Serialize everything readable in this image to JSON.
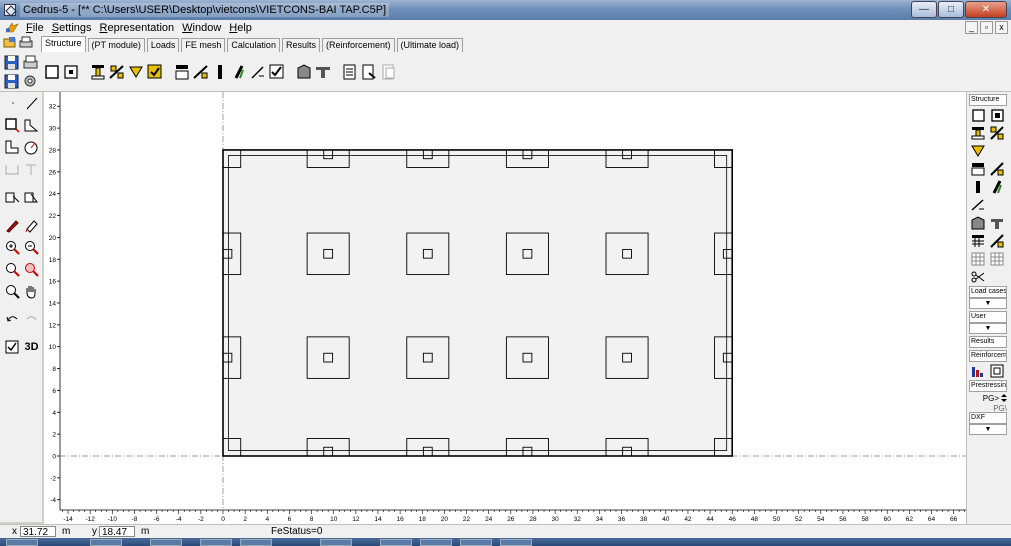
{
  "window": {
    "title": "Cedrus-5 - [** C:\\Users\\USER\\Desktop\\vietcons\\VIETCONS-BAI TAP.C5P]",
    "minimize": "—",
    "maximize": "□",
    "close": "✕"
  },
  "menu": {
    "items": [
      {
        "key": "F",
        "rest": "ile"
      },
      {
        "key": "S",
        "rest": "ettings"
      },
      {
        "key": "R",
        "rest": "epresentation"
      },
      {
        "key": "W",
        "rest": "indow"
      },
      {
        "key": "H",
        "rest": "elp"
      }
    ],
    "mdi": [
      "_",
      "▫",
      "x"
    ]
  },
  "tabs": [
    {
      "label": "Structure",
      "active": true
    },
    {
      "label": "(PT module)",
      "active": false
    },
    {
      "label": "Loads",
      "active": false
    },
    {
      "label": "FE mesh",
      "active": false
    },
    {
      "label": "Calculation",
      "active": false
    },
    {
      "label": "Results",
      "active": false
    },
    {
      "label": "(Reinforcement)",
      "active": false
    },
    {
      "label": "(Ultimate load)",
      "active": false
    }
  ],
  "left_toolbar": {
    "three_d_label": "3D"
  },
  "axes": {
    "y_ticks": [
      32,
      30,
      28,
      26,
      24,
      22,
      20,
      18,
      16,
      14,
      12,
      10,
      8,
      6,
      4,
      2,
      0,
      -2,
      -4
    ],
    "x_ticks": [
      -14,
      -12,
      -10,
      -8,
      -6,
      -4,
      -2,
      0,
      2,
      4,
      6,
      8,
      10,
      12,
      14,
      16,
      18,
      20,
      22,
      24,
      26,
      28,
      30,
      32,
      34,
      36,
      38,
      40,
      42,
      44,
      46,
      48,
      50,
      52,
      54,
      56,
      58,
      60,
      62,
      64,
      66
    ]
  },
  "structure": {
    "slab": {
      "x0": 0,
      "y0": 0,
      "x1": 46,
      "y1": 28
    },
    "column_rows_y": [
      9,
      18.5
    ],
    "column_cols_x": [
      9.5,
      18.5,
      27.5,
      36.5
    ]
  },
  "right_panel": {
    "structure": "Structure",
    "load_cases": "Load cases",
    "user": "User",
    "results": "Results",
    "reinforcement": "Reinforcem",
    "prestressing": "Prestressin",
    "pg_value": "PG>",
    "pg_value2": "PG\\",
    "dxf": "DXF",
    "combo_arrow": "▼"
  },
  "status": {
    "x_label": "x",
    "x_value": "31.72",
    "x_unit": "m",
    "y_label": "y",
    "y_value": "18.47",
    "y_unit": "m",
    "fe_status": "FeStatus=0"
  },
  "colors": {
    "title_bar": "#6f8fb8",
    "canvas_bg": "#ffffff",
    "slab_fill": "#f2f2f2",
    "line": "#000000",
    "close_button": "#c2401f"
  }
}
